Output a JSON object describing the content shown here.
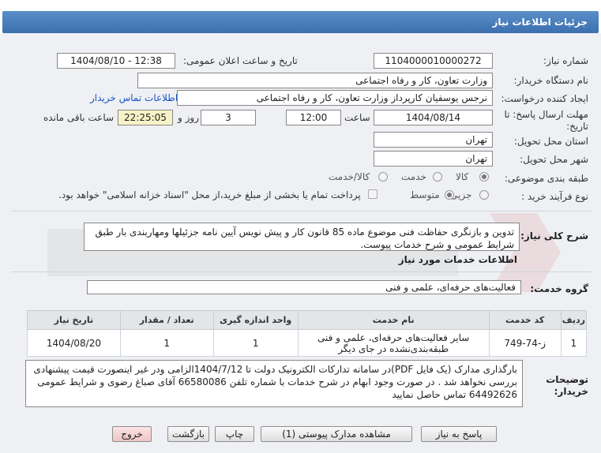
{
  "header": {
    "title": "جزئیات اطلاعات نیاز"
  },
  "fields": {
    "need_number_label": "شماره نیاز:",
    "need_number": "1104000010000272",
    "announce_label": "تاریخ و ساعت اعلان عمومی:",
    "announce_value": "1404/08/10 - 12:38",
    "buyer_org_label": "نام دستگاه خریدار:",
    "buyer_org": "وزارت تعاون، کار و رفاه اجتماعی",
    "creator_label": "ایجاد کننده درخواست:",
    "creator": "نرجس یوسفیان کارپرداز وزارت تعاون، کار و رفاه اجتماعی",
    "buyer_contact_link": "اطلاعات تماس خریدار",
    "deadline_label_1": "مهلت ارسال پاسخ: تا",
    "deadline_label_2": "تاریخ:",
    "deadline_date": "1404/08/14",
    "time_label": "ساعت",
    "deadline_time": "12:00",
    "days_value": "3",
    "days_label": "روز و",
    "remaining_time": "22:25:05",
    "remaining_label": "ساعت باقی مانده",
    "province_label": "استان محل تحویل:",
    "province": "تهران",
    "city_label": "شهر محل تحویل:",
    "city": "تهران",
    "category_label": "طبقه بندی موضوعی:",
    "category_options": [
      "کالا",
      "خدمت",
      "کالا/خدمت"
    ],
    "process_label": "نوع فرآیند خرید :",
    "process_options": [
      "جزیی",
      "متوسط"
    ],
    "payment_note": "پرداخت تمام یا بخشی از مبلغ خرید،از محل \"اسناد خزانه اسلامی\" خواهد بود."
  },
  "description": {
    "label": "شرح کلی نیاز:",
    "text": "تدوین و بازنگری حفاظت فنی موضوع ماده 85 قانون کار و پیش نویس آیین نامه جزئیلها ومهاربندی بار طبق شرایط عمومی و شرح خدمات پیوست."
  },
  "services": {
    "section_title": "اطلاعات خدمات مورد نیاز",
    "group_label": "گروه خدمت:",
    "group_value": "فعالیت‌های حرفه‌ای، علمی و فنی",
    "columns": [
      "ردیف",
      "کد خدمت",
      "نام خدمت",
      "واحد اندازه گیری",
      "تعداد / مقدار",
      "تاریخ نیاز"
    ],
    "rows": [
      {
        "index": "1",
        "code": "ز-74-749",
        "name": "سایر فعالیت‌های حرفه‌ای، علمی و فنی طبقه‌بندی‌نشده در جای دیگر",
        "unit": "1",
        "quantity": "1",
        "date": "1404/08/20"
      }
    ]
  },
  "buyer_notes": {
    "label_1": "توضیحات",
    "label_2": "خریدار:",
    "text": "بارگذاری مدارک (یک فایل PDF)در سامانه تدارکات الکترونیک دولت تا 1404/7/12الزامی ودر غیر اینصورت قیمت پیشنهادی بررسی نخواهد شد . در صورت وجود ابهام در شرح خدمات با شماره تلفن 66580086 آقای صباغ رضوی و شرایط عمومی 64492626 تماس حاصل نمایید"
  },
  "buttons": {
    "reply": "پاسخ به نیاز",
    "view_docs": "مشاهده مدارک پیوستی (1)",
    "print": "چاپ",
    "back": "بازگشت",
    "exit": "خروج"
  },
  "colors": {
    "header_bg": "#3b6fae",
    "link": "#1a55c7",
    "remaining_bg": "#f7f3c6",
    "exit_bg": "#f0c6c6"
  }
}
